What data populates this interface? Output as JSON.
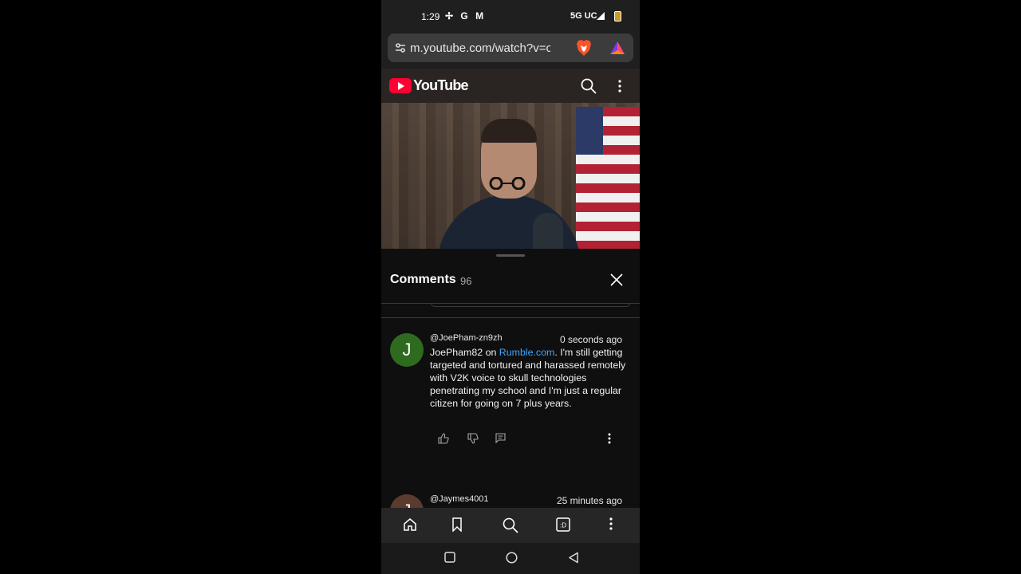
{
  "status_bar": {
    "time": "1:29",
    "icons": [
      "pinwheel-icon",
      "google-icon",
      "gmail-icon"
    ],
    "network": "5G UC",
    "icon_glyphs": [
      "✢",
      "G",
      "M"
    ]
  },
  "browser": {
    "url": "m.youtube.com/watch?v=cyHq"
  },
  "youtube": {
    "brand": "YouTube",
    "brand_color": "#ff0033"
  },
  "comments": {
    "title": "Comments",
    "count": "96",
    "items": [
      {
        "avatar_letter": "J",
        "avatar_color": "#2e6b1e",
        "handle": "@JoePham-zn9zh",
        "time_ago": "0 seconds ago",
        "text_prefix": "JoePham82 on ",
        "text_link": "Rumble.com",
        "text_rest": ". I'm still getting targeted and tortured and harassed remotely with V2K voice to skull technologies penetrating my school and I'm just a regular citizen for going on 7 plus years."
      },
      {
        "avatar_letter": "J",
        "avatar_color": "#5a3b2e",
        "handle": "@Jaymes4001",
        "time_ago": "25 minutes ago"
      }
    ]
  },
  "link_color": "#3ea6ff"
}
